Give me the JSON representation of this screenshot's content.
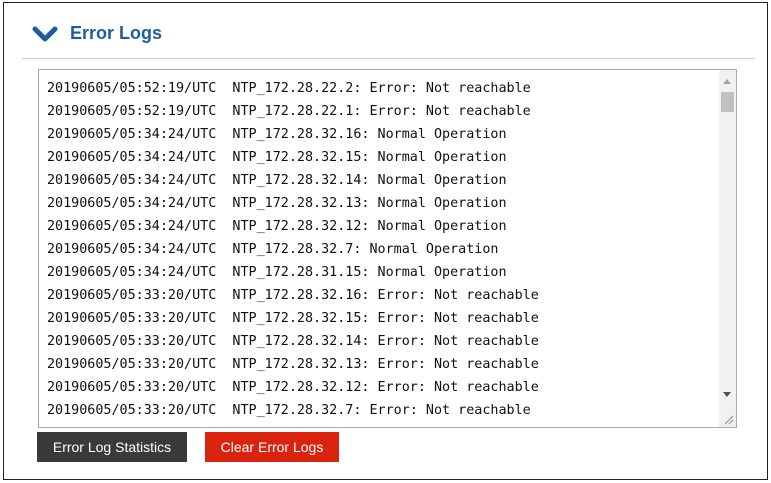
{
  "section": {
    "title": "Error Logs",
    "expand_icon": "chevron-down-icon",
    "accent_color": "#1f5c9e"
  },
  "log": {
    "lines": [
      "20190605/05:52:19/UTC  NTP_172.28.22.2: Error: Not reachable",
      "20190605/05:52:19/UTC  NTP_172.28.22.1: Error: Not reachable",
      "20190605/05:34:24/UTC  NTP_172.28.32.16: Normal Operation",
      "20190605/05:34:24/UTC  NTP_172.28.32.15: Normal Operation",
      "20190605/05:34:24/UTC  NTP_172.28.32.14: Normal Operation",
      "20190605/05:34:24/UTC  NTP_172.28.32.13: Normal Operation",
      "20190605/05:34:24/UTC  NTP_172.28.32.12: Normal Operation",
      "20190605/05:34:24/UTC  NTP_172.28.32.7: Normal Operation",
      "20190605/05:34:24/UTC  NTP_172.28.31.15: Normal Operation",
      "20190605/05:33:20/UTC  NTP_172.28.32.16: Error: Not reachable",
      "20190605/05:33:20/UTC  NTP_172.28.32.15: Error: Not reachable",
      "20190605/05:33:20/UTC  NTP_172.28.32.14: Error: Not reachable",
      "20190605/05:33:20/UTC  NTP_172.28.32.13: Error: Not reachable",
      "20190605/05:33:20/UTC  NTP_172.28.32.12: Error: Not reachable",
      "20190605/05:33:20/UTC  NTP_172.28.32.7: Error: Not reachable"
    ]
  },
  "actions": {
    "stats_label": "Error Log Statistics",
    "stats_color": "#3a3a3a",
    "clear_label": "Clear Error Logs",
    "clear_color": "#d9230f"
  }
}
